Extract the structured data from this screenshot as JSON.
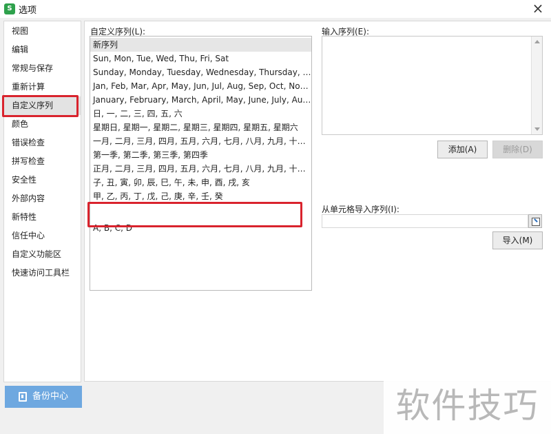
{
  "window": {
    "title": "选项",
    "app_icon_glyph": "S",
    "close_label": "×"
  },
  "nav": {
    "items": [
      {
        "label": "视图"
      },
      {
        "label": "编辑"
      },
      {
        "label": "常规与保存"
      },
      {
        "label": "重新计算"
      },
      {
        "label": "自定义序列"
      },
      {
        "label": "颜色"
      },
      {
        "label": "错误检查"
      },
      {
        "label": "拼写检查"
      },
      {
        "label": "安全性"
      },
      {
        "label": "外部内容"
      },
      {
        "label": "新特性"
      },
      {
        "label": "信任中心"
      },
      {
        "label": "自定义功能区"
      },
      {
        "label": "快速访问工具栏"
      }
    ],
    "active": "自定义序列",
    "backup_label": "备份中心"
  },
  "custom_lists": {
    "label": "自定义序列(L):",
    "items": [
      "新序列",
      "Sun, Mon, Tue, Wed, Thu, Fri, Sat",
      "Sunday, Monday, Tuesday, Wednesday, Thursday, Frida...",
      "Jan, Feb, Mar, Apr, May, Jun, Jul, Aug, Sep, Oct, Nov, Dec",
      "January, February, March, April, May, June, July, August,...",
      "日, 一, 二, 三, 四, 五, 六",
      "星期日, 星期一, 星期二, 星期三, 星期四, 星期五, 星期六",
      "一月, 二月, 三月, 四月, 五月, 六月, 七月, 八月, 九月, 十月, 十...",
      "第一季, 第二季, 第三季, 第四季",
      "正月, 二月, 三月, 四月, 五月, 六月, 七月, 八月, 九月, 十月, 十...",
      "子, 丑, 寅, 卯, 辰, 巳, 午, 未, 申, 酉, 戌, 亥",
      "甲, 乙, 丙, 丁, 戊, 己, 庚, 辛, 壬, 癸",
      "A, B, C, D"
    ],
    "selected_index": 0
  },
  "entries": {
    "label": "输入序列(E):",
    "value": ""
  },
  "buttons": {
    "add": "添加(A)",
    "delete": "删除(D)",
    "import": "导入(M)"
  },
  "import_from_cells": {
    "label": "从单元格导入序列(I):",
    "value": ""
  },
  "watermark": "软件技巧",
  "colors": {
    "highlight": "#d9232d",
    "backup_button": "#6ea8e0",
    "app_icon": "#2ea14c"
  }
}
